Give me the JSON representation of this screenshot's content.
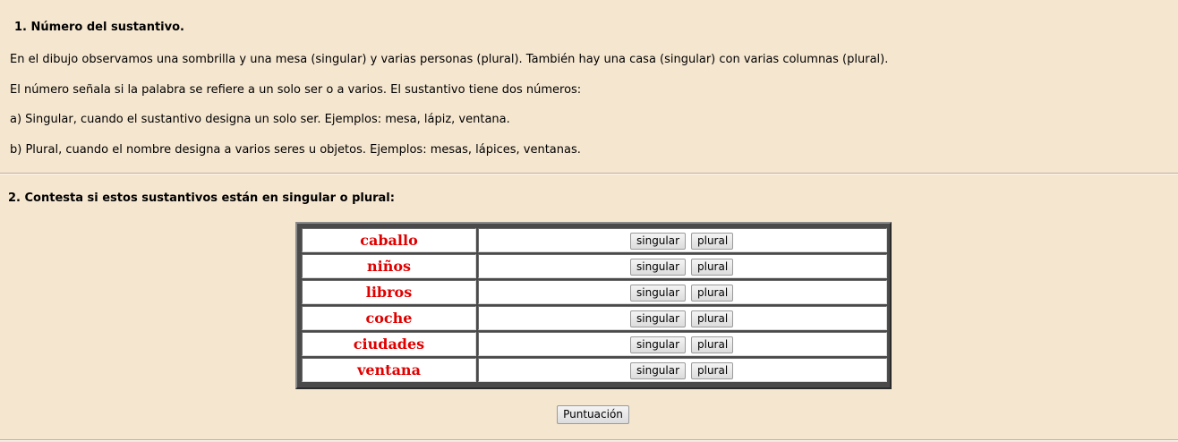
{
  "section1": {
    "title": "1. Número del sustantivo.",
    "paragraphs": [
      "En el dibujo observamos una sombrilla y una mesa (singular) y varias personas (plural). También hay una casa (singular) con varias columnas (plural).",
      "El número señala si la palabra se refiere a un solo ser o a varios. El sustantivo tiene dos números:",
      "a) Singular, cuando el sustantivo designa un solo ser. Ejemplos: mesa, lápiz, ventana.",
      "b) Plural, cuando el nombre designa a varios seres u objetos. Ejemplos: mesas, lápices, ventanas."
    ]
  },
  "section2": {
    "title": "2. Contesta si estos sustantivos están en singular o plural:"
  },
  "exercise": {
    "rows": [
      {
        "word": "caballo",
        "singular": "singular",
        "plural": "plural"
      },
      {
        "word": "niños",
        "singular": "singular",
        "plural": "plural"
      },
      {
        "word": "libros",
        "singular": "singular",
        "plural": "plural"
      },
      {
        "word": "coche",
        "singular": "singular",
        "plural": "plural"
      },
      {
        "word": "ciudades",
        "singular": "singular",
        "plural": "plural"
      },
      {
        "word": "ventana",
        "singular": "singular",
        "plural": "plural"
      }
    ],
    "score_label": "Puntuación"
  },
  "colors": {
    "background": "#f5e6cf",
    "word": "#e00000",
    "table_frame": "#4a4a4a"
  }
}
